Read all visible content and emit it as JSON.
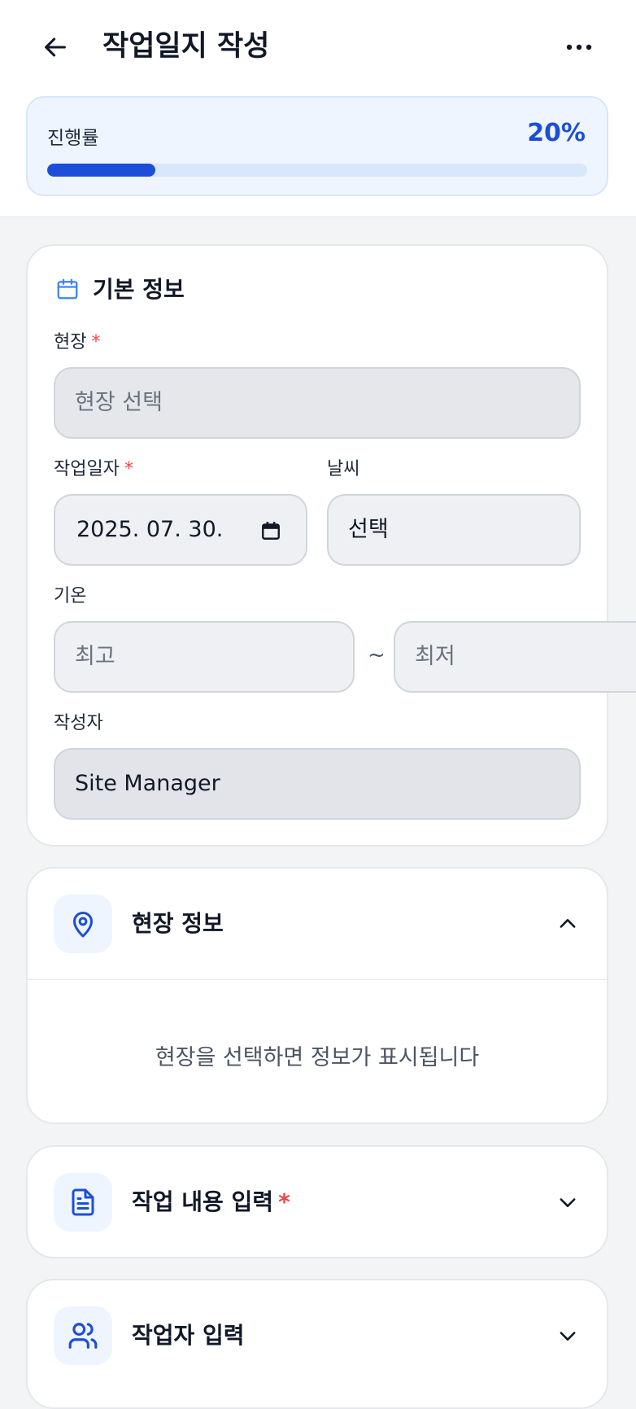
{
  "header": {
    "title": "작업일지 작성",
    "back_icon": "arrow-left-icon",
    "more_icon": "more-horizontal-icon"
  },
  "progress": {
    "label": "진행률",
    "percent_text": "20%",
    "value": 0.2,
    "accent": "#1d4ed8"
  },
  "basic_info": {
    "title": "기본 정보",
    "icon": "calendar-icon",
    "site": {
      "label": "현장",
      "required": "*",
      "placeholder": "현장 선택"
    },
    "work_date": {
      "label": "작업일자",
      "required": "*",
      "value": "2025. 07. 30."
    },
    "weather": {
      "label": "날씨",
      "value": "선택"
    },
    "temperature": {
      "label": "기온",
      "high_placeholder": "최고",
      "separator": "~",
      "low_placeholder": "최저"
    },
    "author": {
      "label": "작성자",
      "value": "Site Manager"
    }
  },
  "site_info": {
    "title": "현장 정보",
    "icon": "map-pin-icon",
    "chevron": "chevron-up-icon",
    "empty_message": "현장을 선택하면 정보가 표시됩니다"
  },
  "work_content": {
    "title": "작업 내용 입력",
    "required": "*",
    "icon": "document-icon",
    "chevron": "chevron-down-icon"
  },
  "workers": {
    "title": "작업자 입력",
    "icon": "users-icon",
    "chevron": "chevron-down-icon"
  }
}
